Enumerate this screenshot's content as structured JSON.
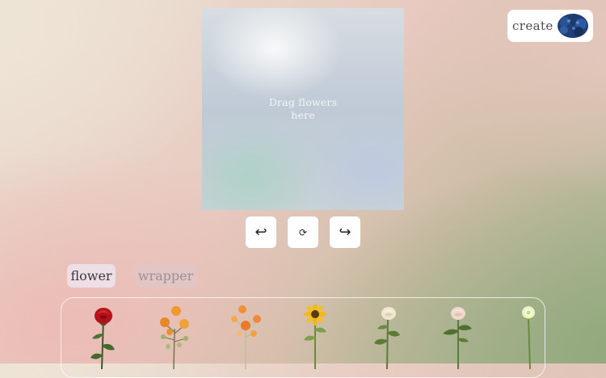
{
  "canvas": {
    "hint": "Drag flowers here"
  },
  "header": {
    "create_label": "create",
    "create_icon": "blue-hydrangea-icon"
  },
  "controls": {
    "undo_glyph": "↩",
    "reset_glyph": "⟳",
    "redo_glyph": "↪"
  },
  "tabs": [
    {
      "label": "flower",
      "active": true
    },
    {
      "label": "wrapper",
      "active": false
    }
  ],
  "flowers": [
    {
      "name": "red-rose",
      "color": "#b3121a"
    },
    {
      "name": "orange-spray-rose",
      "color": "#e98a2a"
    },
    {
      "name": "orange-poppy",
      "color": "#ee8a3a"
    },
    {
      "name": "sunflower",
      "color": "#f2b81a"
    },
    {
      "name": "cream-rose",
      "color": "#efe6cf"
    },
    {
      "name": "peach-rose",
      "color": "#f1d7cc"
    },
    {
      "name": "green-chrysanthemum",
      "color": "#e8f2c4"
    }
  ]
}
